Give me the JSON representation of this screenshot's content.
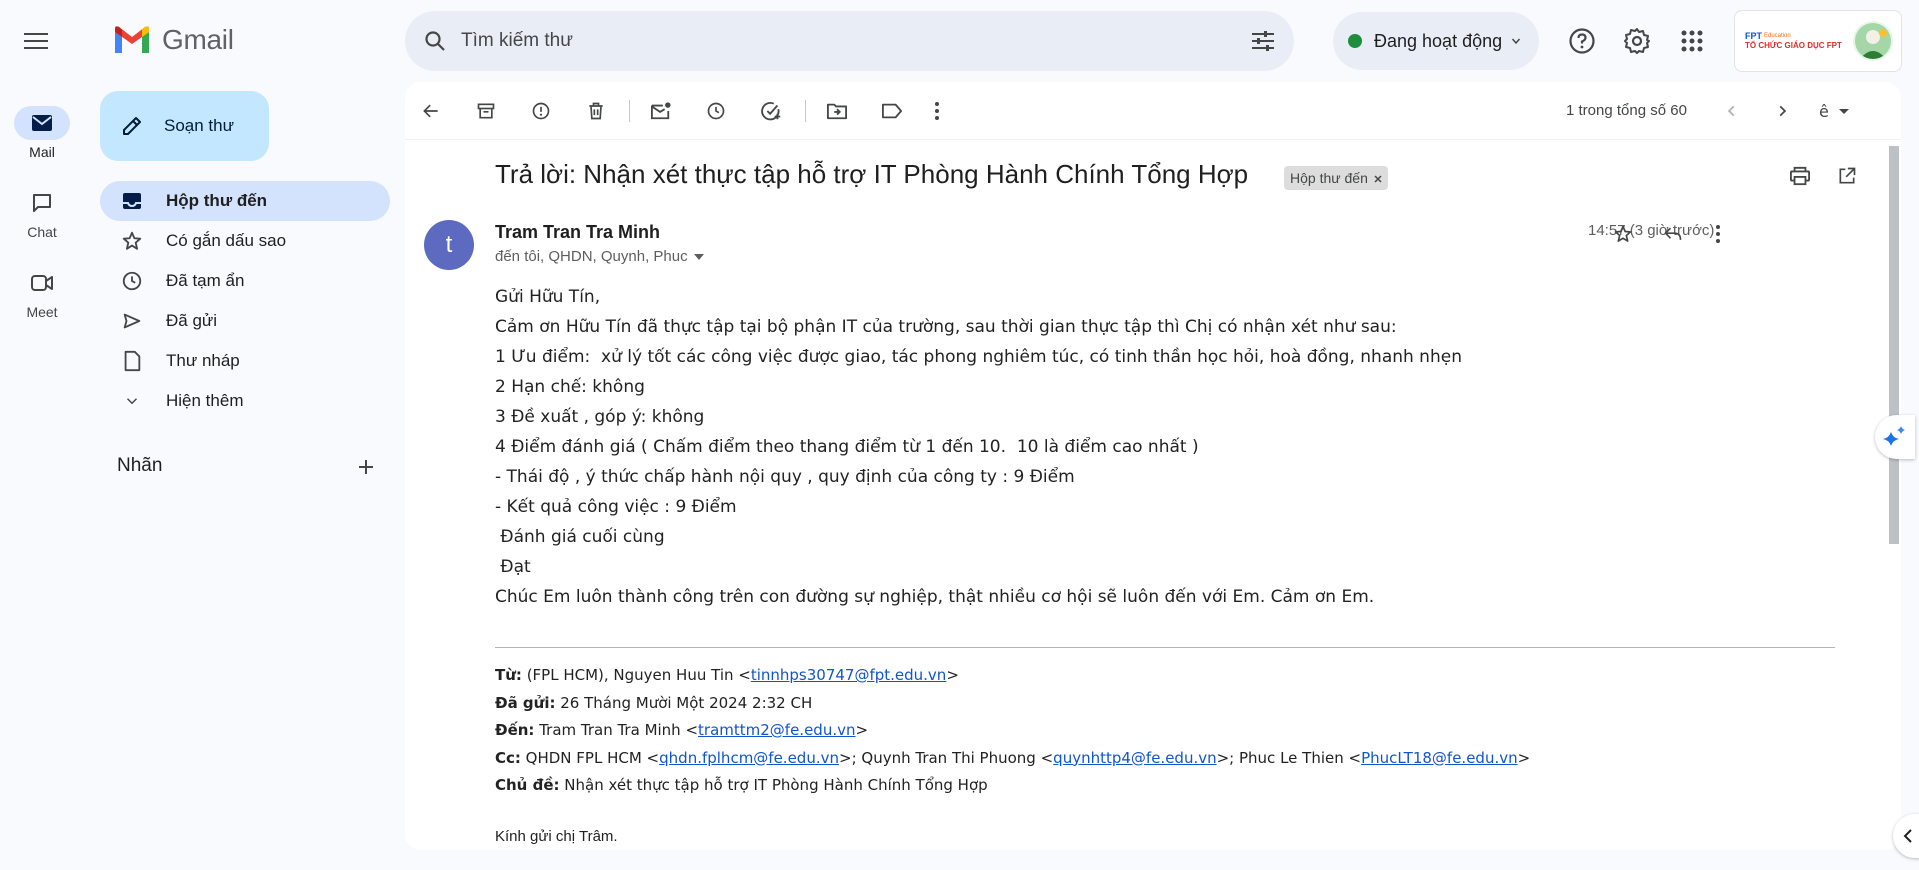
{
  "app": {
    "name": "Gmail"
  },
  "rail": {
    "items": [
      {
        "label": "Mail",
        "icon": "mail-icon",
        "active": true
      },
      {
        "label": "Chat",
        "icon": "chat-icon"
      },
      {
        "label": "Meet",
        "icon": "meet-icon"
      }
    ]
  },
  "compose": {
    "label": "Soạn thư"
  },
  "nav": {
    "items": [
      {
        "label": "Hộp thư đến",
        "icon": "inbox-icon"
      },
      {
        "label": "Có gắn dấu sao",
        "icon": "star-icon"
      },
      {
        "label": "Đã tạm ẩn",
        "icon": "clock-icon"
      },
      {
        "label": "Đã gửi",
        "icon": "send-icon"
      },
      {
        "label": "Thư nháp",
        "icon": "draft-icon"
      },
      {
        "label": "Hiện thêm",
        "icon": "chevron-down-icon"
      }
    ],
    "labels_heading": "Nhãn"
  },
  "search": {
    "placeholder": "Tìm kiếm thư"
  },
  "status": {
    "label": "Đang hoạt động",
    "color": "#1e8e3e"
  },
  "account": {
    "org_text": "TỔ CHỨC GIÁO DỤC FPT",
    "brand": "FPT",
    "brand_sub": "Education"
  },
  "toolbar": {
    "pager": "1 trong tổng số 60"
  },
  "email": {
    "subject": "Trả lời: Nhận xét thực tập hỗ trợ IT Phòng Hành Chính Tổng Hợp",
    "label_chip": "Hộp thư đến",
    "avatar_letter": "t",
    "sender": "Tram Tran Tra Minh",
    "recipients": "đến tôi, QHDN, Quynh, Phuc",
    "time": "14:57 (3 giờ trước)",
    "body": [
      "Gửi Hữu Tín,",
      "Cảm ơn Hữu Tín đã thực tập tại bộ phận IT của trường, sau thời gian thực tập thì Chị có nhận xét như sau:",
      "1 Ưu điểm:  xử lý tốt các công việc được giao, tác phong nghiêm túc, có tinh thần học hỏi, hoà đồng, nhanh nhẹn",
      "2 Hạn chế: không",
      "3 Đề xuất , góp ý: không",
      "4 Điểm đánh giá ( Chấm điểm theo thang điểm từ 1 đến 10.  10 là điểm cao nhất )",
      "- Thái độ , ý thức chấp hành nội quy , quy định của công ty : 9 Điểm",
      "- Kết quả công việc : 9 Điểm",
      " Đánh giá cuối cùng",
      " Đạt",
      "Chúc Em luôn thành công trên con đường sự nghiệp, thật nhiều cơ hội sẽ luôn đến với Em. Cảm ơn Em."
    ],
    "quote": {
      "from_label": "Từ:",
      "from_text": " (FPL HCM), Nguyen Huu Tin <",
      "from_email": "tinnhps30747@fpt.edu.vn",
      "sent_label": "Đã gửi:",
      "sent_text": " 26 Tháng Mười Một 2024 2:32 CH",
      "to_label": "Đến:",
      "to_text": " Tram Tran Tra Minh <",
      "to_email": "tramttm2@fe.edu.vn",
      "cc_label": "Cc:",
      "cc_text1": " QHDN FPL HCM <",
      "cc_email1": "qhdn.fplhcm@fe.edu.vn",
      "cc_text2": ">; Quynh Tran Thi Phuong <",
      "cc_email2": "quynhttp4@fe.edu.vn",
      "cc_text3": ">; Phuc Le Thien <",
      "cc_email3": "PhucLT18@fe.edu.vn",
      "subject_label": "Chủ đề:",
      "subject_text": " Nhận xét thực tập hỗ trợ IT Phòng Hành Chính Tổng Hợp",
      "close": ">",
      "greeting": "Kính gửi chị Trâm."
    }
  }
}
